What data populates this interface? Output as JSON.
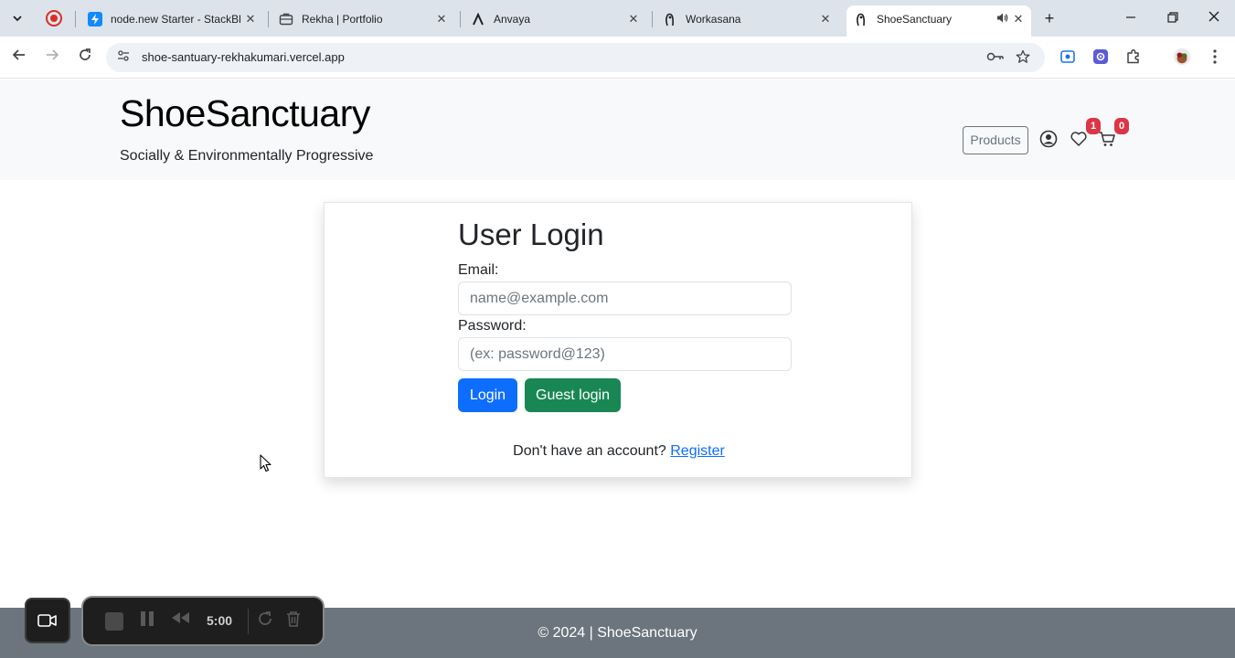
{
  "browser": {
    "tabs": [
      {
        "title": "node.new Starter - StackBl",
        "icon": "stackblitz-icon"
      },
      {
        "title": "Rekha | Portfolio",
        "icon": "portfolio-icon"
      },
      {
        "title": "Anvaya",
        "icon": "anvaya-icon"
      },
      {
        "title": "Workasana",
        "icon": "workasana-icon"
      },
      {
        "title": "ShoeSanctuary",
        "icon": "shoe-icon",
        "active": true
      }
    ],
    "url": "shoe-santuary-rekhakumari.vercel.app"
  },
  "header": {
    "brand": "ShoeSanctuary",
    "tagline": "Socially & Environmentally Progressive",
    "products_label": "Products",
    "wishlist_count": "1",
    "cart_count": "0"
  },
  "login": {
    "title": "User Login",
    "email_label": "Email:",
    "email_placeholder": "name@example.com",
    "password_label": "Password:",
    "password_placeholder": "(ex: password@123)",
    "login_button": "Login",
    "guest_button": "Guest login",
    "register_prompt": "Don't have an account?",
    "register_link": "Register"
  },
  "footer": {
    "text": "© 2024 | ShoeSanctuary"
  },
  "recorder": {
    "time": "5:00"
  },
  "colors": {
    "primary": "#0d6efd",
    "success": "#198754",
    "danger": "#dc3545",
    "footer_bg": "#6c757d",
    "header_bg": "#f8f9fa"
  }
}
